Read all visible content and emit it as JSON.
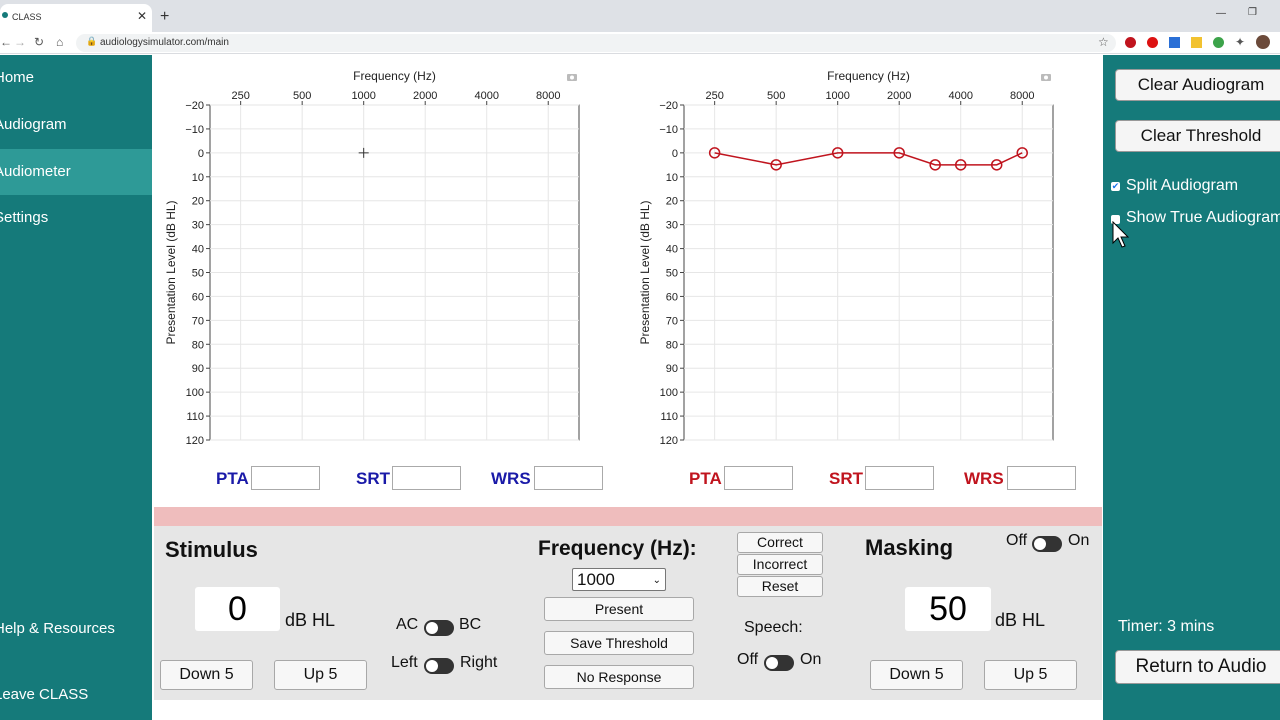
{
  "browser": {
    "tab_title": "CLASS",
    "url": "audiologysimulator.com/main"
  },
  "sidebar": {
    "items": [
      {
        "label": "Home"
      },
      {
        "label": "Audiogram"
      },
      {
        "label": "Audiometer",
        "active": true
      },
      {
        "label": "Settings"
      },
      {
        "label": "Help & Resources"
      },
      {
        "label": "Leave CLASS"
      }
    ]
  },
  "audiogram": {
    "x_title": "Frequency (Hz)",
    "y_title": "Presentation Level (dB HL)",
    "freq_ticks": [
      "250",
      "500",
      "1000",
      "2000",
      "4000",
      "8000"
    ],
    "level_ticks": [
      "−20",
      "−10",
      "0",
      "10",
      "20",
      "30",
      "40",
      "50",
      "60",
      "70",
      "80",
      "90",
      "100",
      "110",
      "120"
    ],
    "left_ear": {
      "pta_label": "PTA",
      "srt_label": "SRT",
      "wrs_label": "WRS",
      "color": "#1a1aa8"
    },
    "right_ear": {
      "pta_label": "PTA",
      "srt_label": "SRT",
      "wrs_label": "WRS",
      "color": "#c0141e"
    }
  },
  "chart_data": [
    {
      "type": "line",
      "title": "",
      "xlabel": "Frequency (Hz)",
      "ylabel": "Presentation Level (dB HL)",
      "x_scale": "log",
      "y_reversed": true,
      "xlim": [
        177,
        11314
      ],
      "ylim": [
        -20,
        120
      ],
      "grid": true,
      "series": [],
      "cursor": {
        "x": 1000,
        "y": 0
      }
    },
    {
      "type": "line",
      "title": "",
      "xlabel": "Frequency (Hz)",
      "ylabel": "Presentation Level (dB HL)",
      "x_scale": "log",
      "y_reversed": true,
      "xlim": [
        177,
        11314
      ],
      "ylim": [
        -20,
        120
      ],
      "grid": true,
      "series": [
        {
          "color": "#c0141e",
          "marker": "circle",
          "x": [
            250,
            500,
            1000,
            2000,
            3000,
            4000,
            6000,
            8000
          ],
          "y": [
            0,
            5,
            0,
            0,
            5,
            5,
            5,
            0
          ]
        }
      ]
    }
  ],
  "controls": {
    "stimulus": {
      "title": "Stimulus",
      "level": "0",
      "unit": "dB HL",
      "down_label": "Down 5",
      "up_label": "Up 5"
    },
    "ac_bc": {
      "left_text": "AC",
      "right_text": "BC"
    },
    "ear": {
      "left_text": "Left",
      "right_text": "Right"
    },
    "frequency": {
      "title": "Frequency (Hz):",
      "selected": "1000",
      "present_label": "Present",
      "save_label": "Save Threshold",
      "no_response_label": "No Response"
    },
    "speech_buttons": {
      "correct": "Correct",
      "incorrect": "Incorrect",
      "reset": "Reset"
    },
    "speech": {
      "label": "Speech:",
      "off": "Off",
      "on": "On"
    },
    "masking": {
      "title": "Masking",
      "off": "Off",
      "on": "On",
      "level": "50",
      "unit": "dB HL",
      "down_label": "Down 5",
      "up_label": "Up 5"
    }
  },
  "right_panel": {
    "clear_audiogram": "Clear Audiogram",
    "clear_threshold": "Clear Threshold",
    "split_audiogram": {
      "label": "Split Audiogram",
      "checked": true
    },
    "show_true": {
      "label": "Show True Audiogram",
      "checked": false
    },
    "timer": "Timer: 3 mins",
    "return_label": "Return to Audio"
  }
}
